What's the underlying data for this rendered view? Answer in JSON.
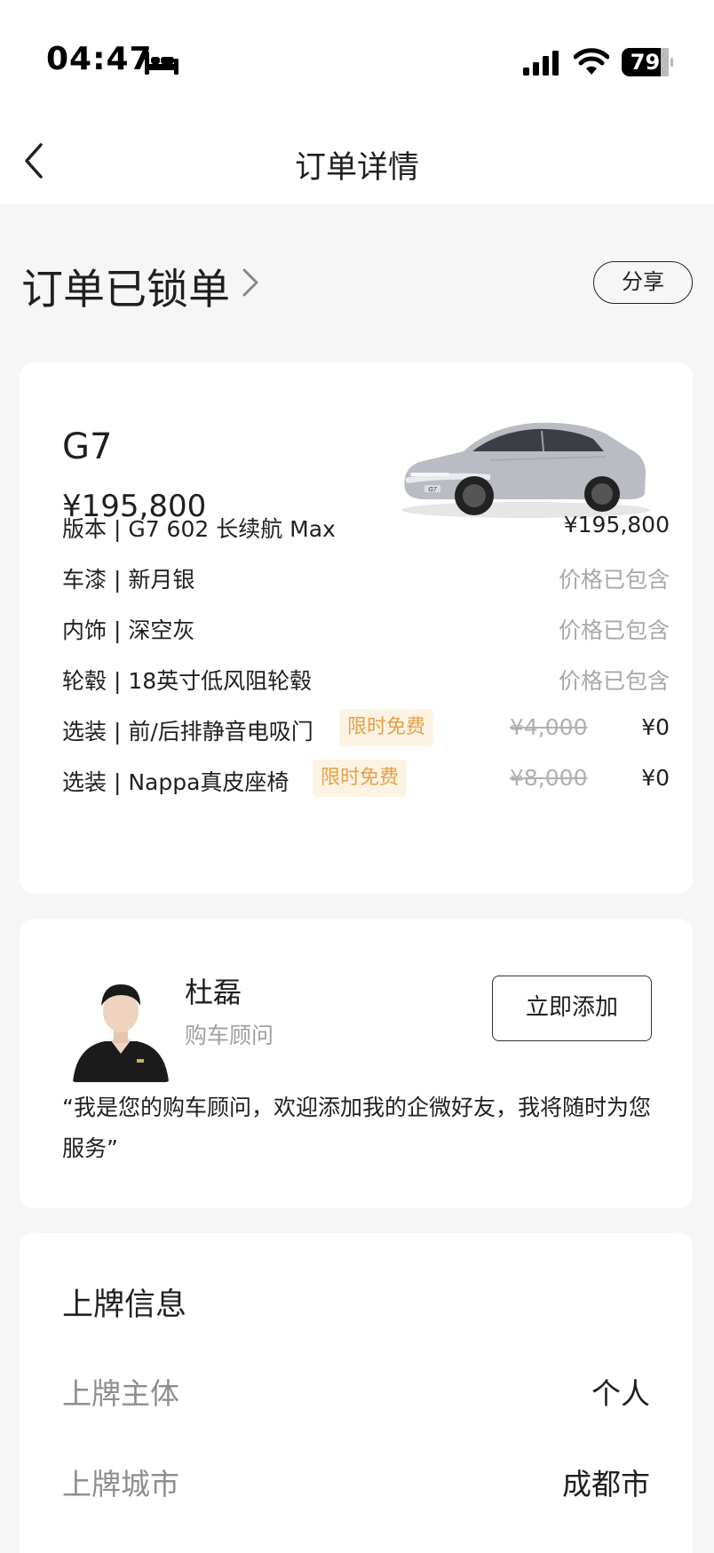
{
  "status_bar": {
    "time": "04:47",
    "battery": "79"
  },
  "nav": {
    "title": "订单详情"
  },
  "order": {
    "status": "订单已锁单",
    "share_label": "分享"
  },
  "car": {
    "name": "G7",
    "price": "¥195,800",
    "badge_text": "G7",
    "config": [
      {
        "label": "版本 | G7 602 长续航 Max",
        "price": "¥195,800"
      },
      {
        "label": "车漆 | 新月银",
        "price": "价格已包含"
      },
      {
        "label": "内饰 | 深空灰",
        "price": "价格已包含"
      },
      {
        "label": "轮毂 | 18英寸低风阻轮毂",
        "price": "价格已包含"
      },
      {
        "label": "选装 | 前/后排静音电吸门",
        "badge": "限时免费",
        "original_price": "¥4,000",
        "price": "¥0"
      },
      {
        "label": "选装 | Nappa真皮座椅",
        "badge": "限时免费",
        "original_price": "¥8,000",
        "price": "¥0"
      }
    ]
  },
  "advisor": {
    "name": "杜磊",
    "role": "购车顾问",
    "add_label": "立即添加",
    "quote": "“我是您的购车顾问，欢迎添加我的企微好友，我将随时为您服务”"
  },
  "plate": {
    "title": "上牌信息",
    "rows": [
      {
        "label": "上牌主体",
        "value": "个人"
      },
      {
        "label": "上牌城市",
        "value": "成都市"
      }
    ]
  },
  "colors": {
    "promo_bg": "#fdf3e3",
    "promo_text": "#e3a14b",
    "muted": "#a8a8a8",
    "page_bg": "#f6f6f6"
  }
}
